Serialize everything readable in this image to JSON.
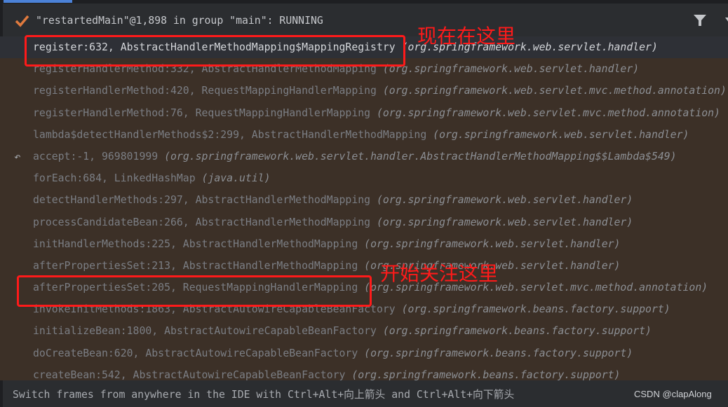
{
  "thread": {
    "label": "\"restartedMain\"@1,898 in group \"main\": RUNNING"
  },
  "frames": [
    {
      "method": "register:632, AbstractHandlerMethodMapping$MappingRegistry",
      "package": "(org.springframework.web.servlet.handler)",
      "selected": true
    },
    {
      "method": "registerHandlerMethod:332, AbstractHandlerMethodMapping",
      "package": "(org.springframework.web.servlet.handler)"
    },
    {
      "method": "registerHandlerMethod:420, RequestMappingHandlerMapping",
      "package": "(org.springframework.web.servlet.mvc.method.annotation)"
    },
    {
      "method": "registerHandlerMethod:76, RequestMappingHandlerMapping",
      "package": "(org.springframework.web.servlet.mvc.method.annotation)"
    },
    {
      "method": "lambda$detectHandlerMethods$2:299, AbstractHandlerMethodMapping",
      "package": "(org.springframework.web.servlet.handler)"
    },
    {
      "method": "accept:-1, 969801999",
      "package": "(org.springframework.web.servlet.handler.AbstractHandlerMethodMapping$$Lambda$549)"
    },
    {
      "method": "forEach:684, LinkedHashMap",
      "package": "(java.util)"
    },
    {
      "method": "detectHandlerMethods:297, AbstractHandlerMethodMapping",
      "package": "(org.springframework.web.servlet.handler)"
    },
    {
      "method": "processCandidateBean:266, AbstractHandlerMethodMapping",
      "package": "(org.springframework.web.servlet.handler)"
    },
    {
      "method": "initHandlerMethods:225, AbstractHandlerMethodMapping",
      "package": "(org.springframework.web.servlet.handler)"
    },
    {
      "method": "afterPropertiesSet:213, AbstractHandlerMethodMapping",
      "package": "(org.springframework.web.servlet.handler)"
    },
    {
      "method": "afterPropertiesSet:205, RequestMappingHandlerMapping",
      "package": "(org.springframework.web.servlet.mvc.method.annotation)"
    },
    {
      "method": "invokeInitMethods:1863, AbstractAutowireCapableBeanFactory",
      "package": "(org.springframework.beans.factory.support)"
    },
    {
      "method": "initializeBean:1800, AbstractAutowireCapableBeanFactory",
      "package": "(org.springframework.beans.factory.support)"
    },
    {
      "method": "doCreateBean:620, AbstractAutowireCapableBeanFactory",
      "package": "(org.springframework.beans.factory.support)"
    },
    {
      "method": "createBean:542, AbstractAutowireCapableBeanFactory",
      "package": "(org.springframework.beans.factory.support)"
    }
  ],
  "footer": {
    "hint": "Switch frames from anywhere in the IDE with Ctrl+Alt+向上箭头 and Ctrl+Alt+向下箭头",
    "watermark": "CSDN @clapAlong"
  },
  "annotations": {
    "current": "现在在这里",
    "focus": "开始关注这里",
    "color": "#ff1a1a"
  },
  "icons": {
    "status": "check-icon",
    "filter": "filter-icon",
    "more": "chevron-down-icon",
    "async": "return-arrow-icon"
  }
}
